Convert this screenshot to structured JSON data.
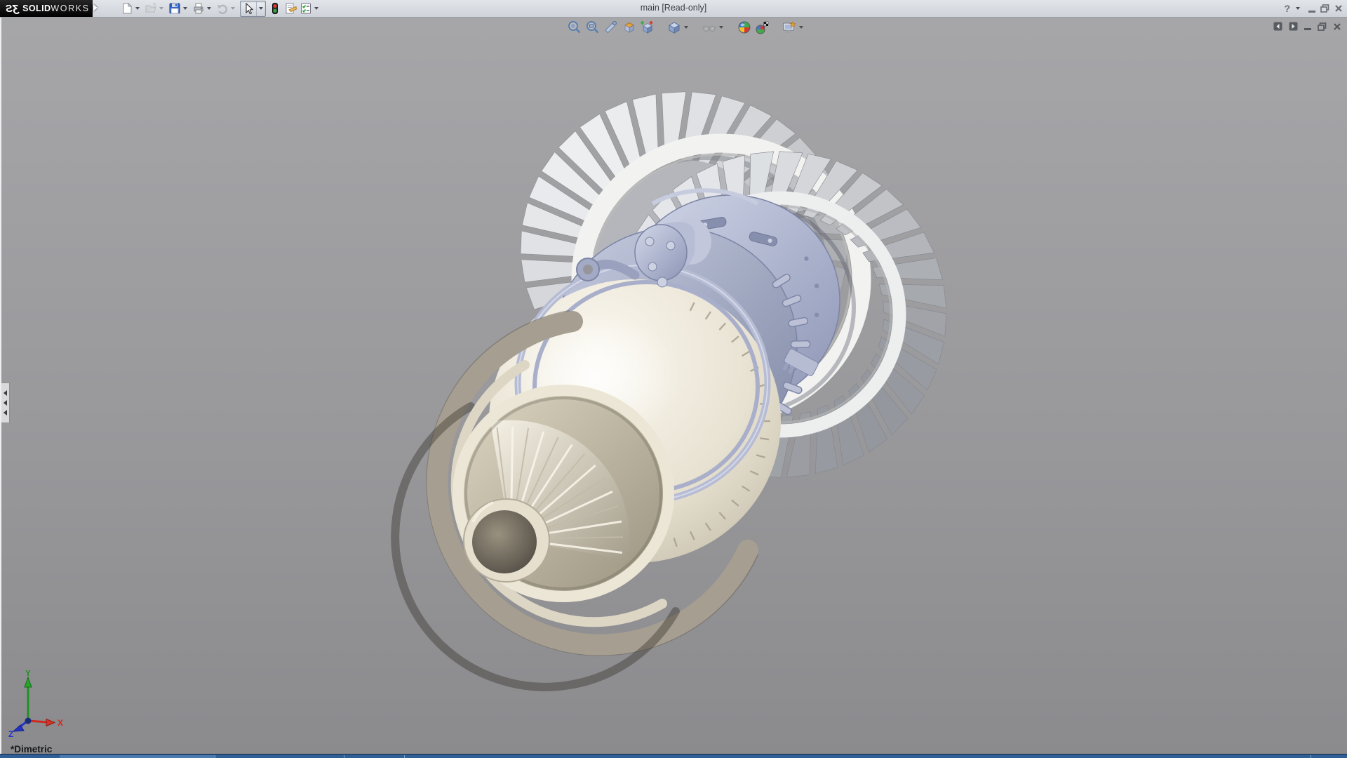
{
  "titlebar": {
    "logo_glyph": "ƷS",
    "logo_text_bold": "SOLID",
    "logo_text_light": "WORKS",
    "document_title": "main [Read-only]",
    "help_glyph": "?"
  },
  "standard_toolbar": {
    "items": [
      {
        "name": "new-document",
        "enabled": true,
        "has_dropdown": true
      },
      {
        "name": "open-document",
        "enabled": false,
        "has_dropdown": true
      },
      {
        "name": "save",
        "enabled": true,
        "has_dropdown": true
      },
      {
        "name": "print",
        "enabled": true,
        "has_dropdown": true
      },
      {
        "name": "undo",
        "enabled": false,
        "has_dropdown": true
      },
      {
        "name": "select",
        "enabled": true,
        "active": true,
        "has_dropdown": true
      },
      {
        "name": "rebuild-traffic-light",
        "enabled": true,
        "has_dropdown": false
      },
      {
        "name": "file-properties",
        "enabled": true,
        "has_dropdown": false
      },
      {
        "name": "options",
        "enabled": true,
        "has_dropdown": true
      }
    ]
  },
  "heads_up_toolbar": {
    "items": [
      "zoom-to-fit",
      "zoom-to-area",
      "section-view",
      "view-orientation",
      "previous-view",
      "display-style",
      "hide-show-items",
      "edit-appearance",
      "apply-scene",
      "view-settings"
    ]
  },
  "viewport": {
    "orientation_label": "*Dimetric",
    "triad": {
      "x_label": "X",
      "y_label": "Y",
      "z_label": "Z"
    },
    "model": "jet-engine-turbofan-assembly"
  },
  "window_controls": [
    "help",
    "minimize",
    "restore",
    "close"
  ],
  "document_window_controls": [
    "previous-pane",
    "next-pane",
    "minimize",
    "restore",
    "close"
  ],
  "colors": {
    "taskbar_blue": "#2f5f96",
    "triad_x_red": "#cc2a1e",
    "triad_y_green": "#1e9121",
    "triad_z_blue": "#2334c4",
    "engine_cream": "#e9e3d3",
    "engine_lavender": "#aab1cd",
    "engine_silver": "#d7d9dc",
    "engine_taupe": "#a69e90"
  }
}
